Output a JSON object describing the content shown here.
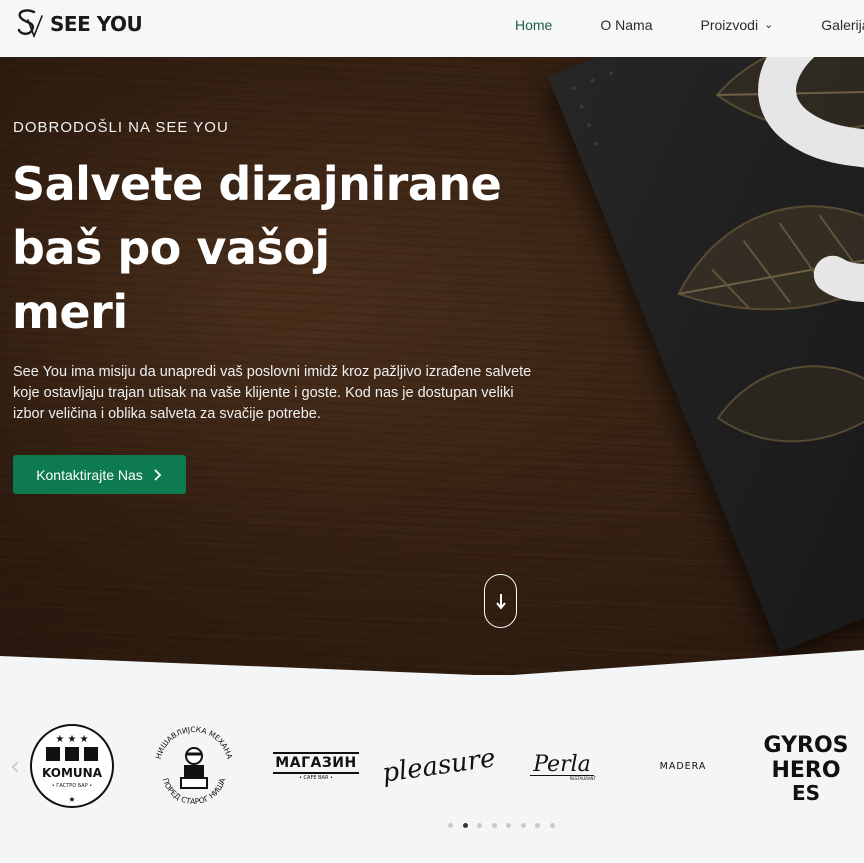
{
  "brand": {
    "name": "SEE YOU"
  },
  "nav": {
    "items": [
      {
        "label": "Home",
        "active": true
      },
      {
        "label": "O Nama"
      },
      {
        "label": "Proizvodi",
        "has_dropdown": true
      },
      {
        "label": "Galerija"
      }
    ]
  },
  "hero": {
    "eyebrow": "DOBRODOŠLI NA SEE YOU",
    "headline_lines": [
      "Salvete dizajnirane",
      "baš po vašoj",
      "meri"
    ],
    "intro_lines": [
      "See You ima misiju da unapredi vaš poslovni imidž kroz pažljivo izrađene salvete",
      "koje ostavljaju trajan utisak na vaše klijente i goste. Kod nas je dostupan veliki",
      "izbor veličina i oblika salveta za svačije potrebe."
    ],
    "cta_label": "Kontaktirajte Nas",
    "cta_icon": "chevron-right-icon",
    "scroll_icon": "arrow-down-icon"
  },
  "clients": {
    "logos": [
      {
        "name": "komuna",
        "text": "KOMUNA",
        "subtext": "• ГАСТРО БАР •"
      },
      {
        "name": "mehana",
        "text_top": "НИШАВЛИЈСКА МЕХАНА",
        "text_bottom": "ПОРЕД СТАРОГ НИША"
      },
      {
        "name": "magazin",
        "text": "МАГАЗИН",
        "subtext": "• CAFE BAR •"
      },
      {
        "name": "pleasure",
        "text": "pleasure"
      },
      {
        "name": "perla",
        "text": "Perla",
        "subtext": "RESTAURANT"
      },
      {
        "name": "madera",
        "text": "MADERA"
      },
      {
        "name": "gyros-heroes",
        "text": "GYROS HEROES"
      }
    ],
    "pagination": {
      "count": 8,
      "active_index": 1
    }
  },
  "colors": {
    "accent": "#0e7a4f",
    "nav_active": "#1b5e3b",
    "page_bg": "#f4f5f7"
  }
}
